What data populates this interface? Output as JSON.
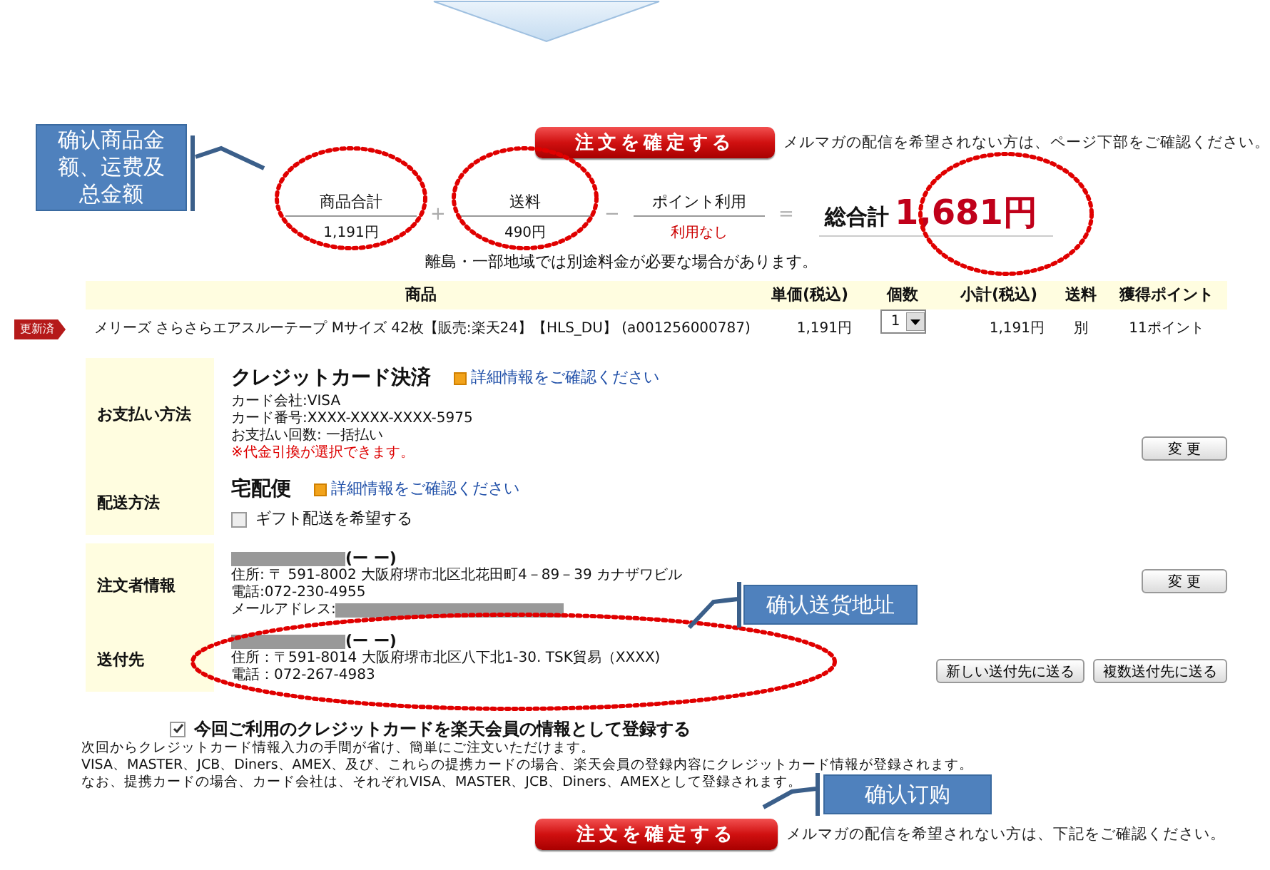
{
  "top_bar": {
    "button": "注文を確定する",
    "note": "メルマガの配信を希望されない方は、ページ下部をご確認ください。"
  },
  "summary": {
    "terms": [
      {
        "kind": "amount",
        "label": "商品合計",
        "value": "1,191円"
      },
      {
        "kind": "operator",
        "symbol": "+"
      },
      {
        "kind": "amount",
        "label": "送料",
        "value": "490円"
      },
      {
        "kind": "operator",
        "symbol": "−"
      },
      {
        "kind": "notice",
        "label": "ポイント利用",
        "value": "利用なし"
      },
      {
        "kind": "operator",
        "symbol": "="
      }
    ],
    "total_label": "総合計",
    "total_value": "1,681円",
    "note": "離島・一部地域では別途料金が必要な場合があります。"
  },
  "table": {
    "columns": [
      "商品",
      "単価(税込)",
      "個数",
      "小計(税込)",
      "送料",
      "獲得ポイント"
    ],
    "rows": [
      {
        "badge": "更新済",
        "product": "メリーズ さらさらエアスルーテープ Mサイズ 42枚【販売:楽天24】【HLS_DU】 (a001256000787)",
        "unit_price": "1,191円",
        "quantity": "1",
        "subtotal": "1,191円",
        "shipping": "別",
        "points": "11ポイント"
      }
    ]
  },
  "sections": [
    {
      "rows": [
        {
          "label": "お支払い方法",
          "title": "クレジットカード決済",
          "link": "詳細情報をご確認ください",
          "lines": [
            "カード会社:VISA",
            "カード番号:XXXX-XXXX-XXXX-5975",
            "お支払い回数: 一括払い"
          ],
          "notice": "※代金引換が選択できます。",
          "buttons": [
            "変 更"
          ]
        },
        {
          "label": "配送方法",
          "title": "宅配便",
          "link": "詳細情報をご確認ください",
          "checkbox": {
            "label": "ギフト配送を希望する",
            "checked": false
          }
        }
      ]
    },
    {
      "rows": [
        {
          "label": "注文者情報",
          "name_suffix": "(ー ー)",
          "lines": [
            "住所: 〒 591-8002 大阪府堺市北区北花田町4－89－39 カナザワビル",
            "電話:072-230-4955"
          ],
          "email_label": "メールアドレス:",
          "buttons": [
            "変 更"
          ]
        },
        {
          "label": "送付先",
          "name_suffix": "(ー ー)",
          "lines": [
            "住所：〒591-8014 大阪府堺市北区八下北1-30. TSK貿易（XXXX)",
            "電話：072-267-4983"
          ],
          "buttons": [
            "新しい送付先に送る",
            "複数送付先に送る"
          ]
        }
      ]
    }
  ],
  "register": {
    "checked": true,
    "label": "今回ご利用のクレジットカードを楽天会員の情報として登録する",
    "lines": [
      "次回からクレジットカード情報入力の手間が省け、簡単にご注文いただけます。",
      "VISA、MASTER、JCB、Diners、AMEX、及び、これらの提携カードの場合、楽天会員の登録内容にクレジットカード情報が登録されます。",
      "なお、提携カードの場合、カード会社は、それぞれVISA、MASTER、JCB、Diners、AMEXとして登録されます。"
    ]
  },
  "bottom_bar": {
    "button": "注文を確定する",
    "note": "メルマガの配信を希望されない方は、下記をご確認ください。"
  },
  "annotations": [
    {
      "text": "确认商品金额、运费及总金额"
    },
    {
      "text": "确认送货地址"
    },
    {
      "text": "确认订购"
    }
  ]
}
